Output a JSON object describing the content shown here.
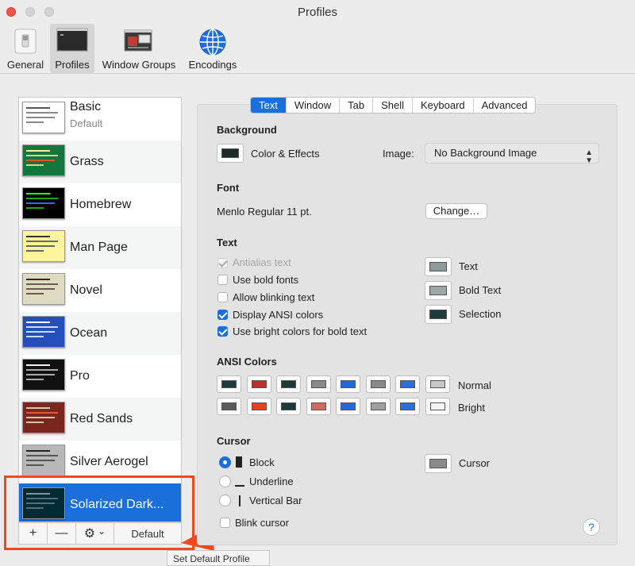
{
  "window": {
    "title": "Profiles"
  },
  "toolbar": {
    "items": [
      {
        "label": "General",
        "icon": "switch-icon"
      },
      {
        "label": "Profiles",
        "icon": "terminal-icon",
        "active": true
      },
      {
        "label": "Window Groups",
        "icon": "window-groups-icon"
      },
      {
        "label": "Encodings",
        "icon": "globe-icon"
      }
    ]
  },
  "profiles": [
    {
      "name": "Basic",
      "sub": "Default",
      "bg": "#ffffff",
      "fg": "#333333"
    },
    {
      "name": "Grass",
      "bg": "#13773d",
      "fg": "#fff0a5"
    },
    {
      "name": "Homebrew",
      "bg": "#000000",
      "fg": "#28fe14"
    },
    {
      "name": "Man Page",
      "bg": "#fef49c",
      "fg": "#000000"
    },
    {
      "name": "Novel",
      "bg": "#dfdbc3",
      "fg": "#3b2322"
    },
    {
      "name": "Ocean",
      "bg": "#224fbc",
      "fg": "#ffffff"
    },
    {
      "name": "Pro",
      "bg": "#000000",
      "fg": "#f2f2f2"
    },
    {
      "name": "Red Sands",
      "bg": "#7a251e",
      "fg": "#d7c9a7"
    },
    {
      "name": "Silver Aerogel",
      "bg": "#929292",
      "fg": "#000000"
    },
    {
      "name": "Solarized Dark...",
      "bg": "#002b36",
      "fg": "#839496",
      "selected": true
    }
  ],
  "list_buttons": {
    "add": "+",
    "remove": "—",
    "gear": "⚙",
    "chevron": "⌄",
    "default": "Default"
  },
  "tooltip": "Set Default Profile",
  "tabs": [
    "Text",
    "Window",
    "Tab",
    "Shell",
    "Keyboard",
    "Advanced"
  ],
  "background": {
    "title": "Background",
    "color_effects": "Color & Effects",
    "image_label": "Image:",
    "image_value": "No Background Image",
    "color": "#1e2a2a"
  },
  "font": {
    "title": "Font",
    "value": "Menlo Regular 11 pt.",
    "change_button": "Change…"
  },
  "text": {
    "title": "Text",
    "options": [
      {
        "label": "Antialias text",
        "checked": true,
        "disabled": true
      },
      {
        "label": "Use bold fonts",
        "checked": false
      },
      {
        "label": "Allow blinking text",
        "checked": false
      },
      {
        "label": "Display ANSI colors",
        "checked": true
      },
      {
        "label": "Use bright colors for bold text",
        "checked": true
      }
    ],
    "colors": [
      {
        "label": "Text",
        "color": "#8e9a9a"
      },
      {
        "label": "Bold Text",
        "color": "#9ea7a7"
      },
      {
        "label": "Selection",
        "color": "#1f3a3a"
      }
    ]
  },
  "ansi": {
    "title": "ANSI Colors",
    "normal_label": "Normal",
    "bright_label": "Bright",
    "normal": [
      "#1e3a3a",
      "#b8342a",
      "#1e3a3a",
      "#8a8a8a",
      "#2368d8",
      "#8a8a8a",
      "#2a6fdb",
      "#c8c8c8"
    ],
    "bright": [
      "#5a5a5a",
      "#e8401e",
      "#1e3a3a",
      "#d46a5c",
      "#2368d8",
      "#a0a0a0",
      "#2a6fdb",
      "#f4f4f4"
    ]
  },
  "cursor": {
    "title": "Cursor",
    "options": [
      {
        "label": "Block",
        "selected": true
      },
      {
        "label": "Underline",
        "selected": false
      },
      {
        "label": "Vertical Bar",
        "selected": false
      }
    ],
    "blink_label": "Blink cursor",
    "color_label": "Cursor",
    "color": "#8a8a8a"
  },
  "help": "?"
}
